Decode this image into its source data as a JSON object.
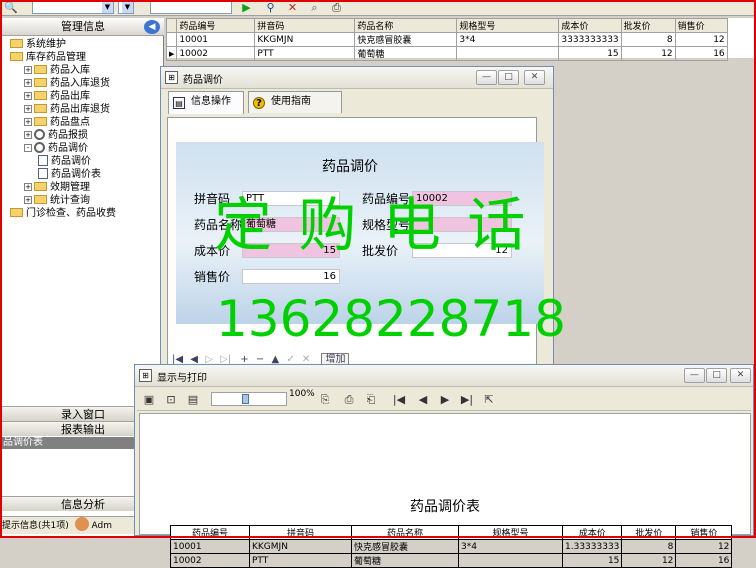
{
  "toolbar": {
    "icons": [
      "search-icon",
      "play-icon",
      "find-icon",
      "close-icon",
      "attach-icon",
      "print-icon"
    ]
  },
  "left_panel": {
    "header": "管理信息",
    "tree": [
      {
        "label": "系统维护",
        "depth": 0,
        "expander": "",
        "icon": "folder"
      },
      {
        "label": "库存药品管理",
        "depth": 0,
        "expander": "",
        "icon": "folder-open"
      },
      {
        "label": "药品入库",
        "depth": 1,
        "expander": "+",
        "icon": "folder"
      },
      {
        "label": "药品入库退货",
        "depth": 1,
        "expander": "+",
        "icon": "folder"
      },
      {
        "label": "药品出库",
        "depth": 1,
        "expander": "+",
        "icon": "folder"
      },
      {
        "label": "药品出库退货",
        "depth": 1,
        "expander": "+",
        "icon": "folder"
      },
      {
        "label": "药品盘点",
        "depth": 1,
        "expander": "+",
        "icon": "folder"
      },
      {
        "label": "药品报损",
        "depth": 1,
        "expander": "+",
        "icon": "gear"
      },
      {
        "label": "药品调价",
        "depth": 1,
        "expander": "-",
        "icon": "gear"
      },
      {
        "label": "药品调价",
        "depth": 2,
        "expander": "",
        "icon": "doc"
      },
      {
        "label": "药品调价表",
        "depth": 2,
        "expander": "",
        "icon": "doc"
      },
      {
        "label": "效期管理",
        "depth": 1,
        "expander": "+",
        "icon": "folder"
      },
      {
        "label": "统计查询",
        "depth": 1,
        "expander": "+",
        "icon": "folder"
      },
      {
        "label": "门诊检查、药品收费",
        "depth": 0,
        "expander": "",
        "icon": "folder"
      }
    ],
    "bottom_bars": [
      "录入窗口",
      "报表输出"
    ],
    "selected_item": "品调价表",
    "info_bar": "信息分析",
    "status": "提示信息(共1项)",
    "user": "Adm"
  },
  "grid": {
    "columns": [
      "药品编号",
      "拼音码",
      "药品名称",
      "规格型号",
      "成本价",
      "批发价",
      "销售价"
    ],
    "rows": [
      [
        "10001",
        "KKGMJN",
        "快克感冒胶囊",
        "3*4",
        "3333333333",
        "8",
        "12"
      ],
      [
        "10002",
        "PTT",
        "葡萄糖",
        "",
        "15",
        "12",
        "16"
      ]
    ]
  },
  "adjust_window": {
    "title": "药品调价",
    "tabs": [
      "信息操作",
      "使用指南"
    ],
    "form_title": "药品调价",
    "fields": {
      "pinyin_label": "拼音码",
      "pinyin_value": "PTT",
      "code_label": "药品编号",
      "code_value": "10002",
      "name_label": "药品名称",
      "name_value": "葡萄糖",
      "spec_label": "规格型号",
      "spec_value": "",
      "cost_label": "成本价",
      "cost_value": "15",
      "wholesale_label": "批发价",
      "wholesale_value": "12",
      "retail_label": "销售价",
      "retail_value": "16"
    },
    "nav_add_label": "增加"
  },
  "print_window": {
    "title": "显示与打印",
    "zoom": "100%",
    "report_title": "药品调价表",
    "columns": [
      "药品编号",
      "拼音码",
      "药品名称",
      "规格型号",
      "成本价",
      "批发价",
      "销售价"
    ],
    "rows": [
      [
        "10001",
        "KKGMJN",
        "快克感冒胶囊",
        "3*4",
        "1.33333333",
        "8",
        "12"
      ],
      [
        "10002",
        "PTT",
        "葡萄糖",
        "",
        "15",
        "12",
        "16"
      ]
    ]
  },
  "watermark": {
    "line1": "定 购 电 话",
    "line2": "13628228718",
    "color": "#00d000"
  }
}
